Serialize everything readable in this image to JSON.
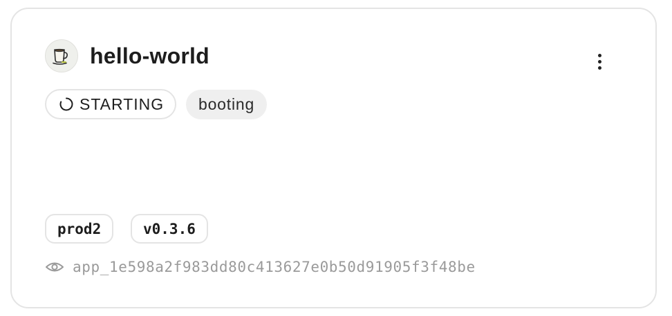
{
  "app": {
    "name": "hello-world",
    "icon": "coffee-cup-icon"
  },
  "status": {
    "label": "STARTING",
    "icon": "spinner-icon",
    "phase": "booting"
  },
  "tags": {
    "environment": "prod2",
    "version": "v0.3.6"
  },
  "identifier": {
    "icon": "eye-icon",
    "value": "app_1e598a2f983dd80c413627e0b50d91905f3f48be"
  },
  "menu": {
    "icon": "more-vertical-icon"
  }
}
